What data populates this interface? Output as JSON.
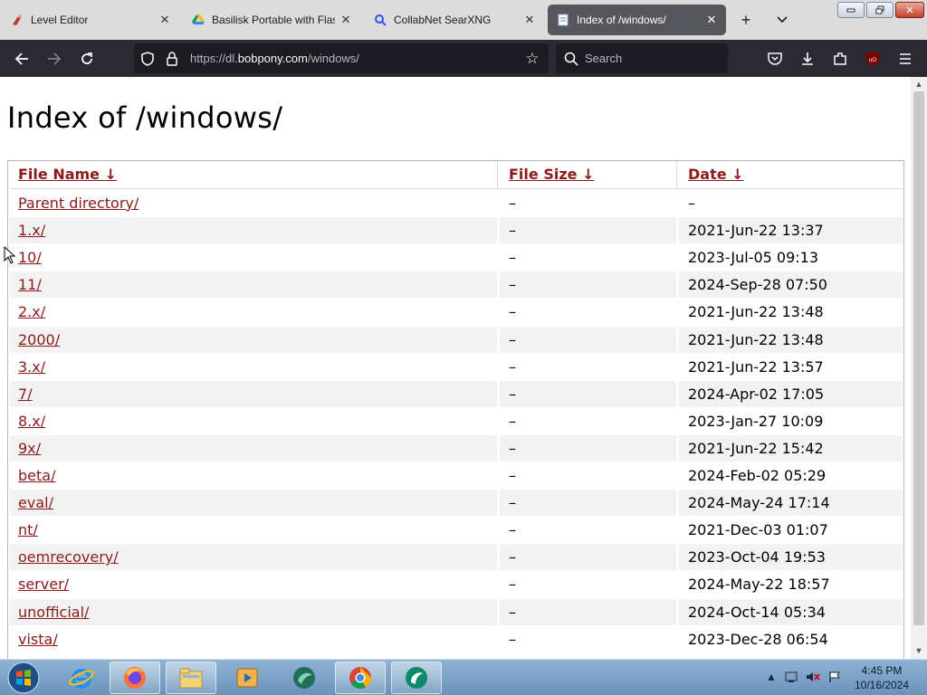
{
  "browser": {
    "tabs": [
      {
        "title": "Level Editor",
        "icon": "level-editor-favicon"
      },
      {
        "title": "Basilisk Portable with Flash",
        "icon": "google-drive-favicon"
      },
      {
        "title": "CollabNet SearXNG",
        "icon": "searxng-favicon"
      },
      {
        "title": "Index of /windows/",
        "icon": "page-favicon",
        "active": true
      }
    ],
    "url_prefix": "https://dl.",
    "url_host": "bobpony.com",
    "url_path": "/windows/",
    "search_placeholder": "Search",
    "new_tab_label": "+",
    "tab_list_label": "⌄",
    "accent": "#2b2a33"
  },
  "page": {
    "title": "Index of /windows/",
    "headers": {
      "name": "File Name",
      "size": "File Size",
      "date": "Date",
      "sort_arrow": "↓"
    },
    "rows": [
      {
        "name": "Parent directory/",
        "size": "–",
        "date": "–"
      },
      {
        "name": "1.x/",
        "size": "–",
        "date": "2021-Jun-22 13:37"
      },
      {
        "name": "10/",
        "size": "–",
        "date": "2023-Jul-05 09:13"
      },
      {
        "name": "11/",
        "size": "–",
        "date": "2024-Sep-28 07:50"
      },
      {
        "name": "2.x/",
        "size": "–",
        "date": "2021-Jun-22 13:48"
      },
      {
        "name": "2000/",
        "size": "–",
        "date": "2021-Jun-22 13:48"
      },
      {
        "name": "3.x/",
        "size": "–",
        "date": "2021-Jun-22 13:57"
      },
      {
        "name": "7/",
        "size": "–",
        "date": "2024-Apr-02 17:05"
      },
      {
        "name": "8.x/",
        "size": "–",
        "date": "2023-Jan-27 10:09"
      },
      {
        "name": "9x/",
        "size": "–",
        "date": "2021-Jun-22 15:42"
      },
      {
        "name": "beta/",
        "size": "–",
        "date": "2024-Feb-02 05:29"
      },
      {
        "name": "eval/",
        "size": "–",
        "date": "2024-May-24 17:14"
      },
      {
        "name": "nt/",
        "size": "–",
        "date": "2021-Dec-03 01:07"
      },
      {
        "name": "oemrecovery/",
        "size": "–",
        "date": "2023-Oct-04 19:53"
      },
      {
        "name": "server/",
        "size": "–",
        "date": "2024-May-22 18:57"
      },
      {
        "name": "unofficial/",
        "size": "–",
        "date": "2024-Oct-14 05:34"
      },
      {
        "name": "vista/",
        "size": "–",
        "date": "2023-Dec-28 06:54"
      }
    ],
    "link_color": "#8b1a1a"
  },
  "taskbar": {
    "apps": [
      "internet-explorer-icon",
      "firefox-icon",
      "file-explorer-icon",
      "media-player-icon",
      "app-icon",
      "chrome-icon",
      "green-app-icon"
    ],
    "clock_time": "4:45 PM",
    "clock_date": "10/16/2024"
  }
}
